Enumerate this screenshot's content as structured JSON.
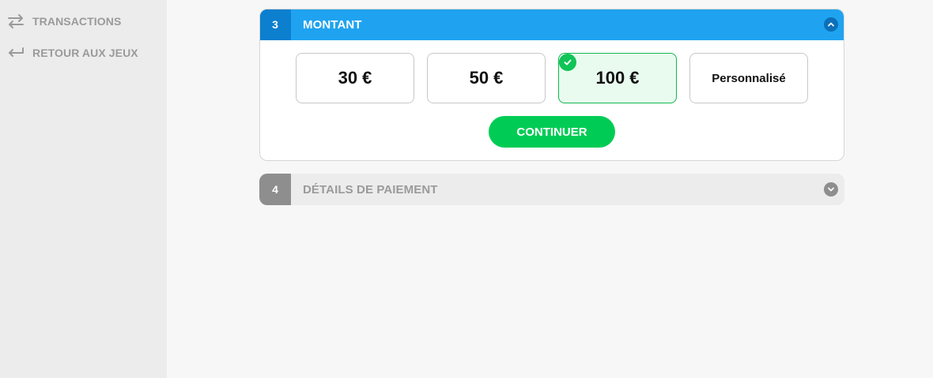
{
  "sidebar": {
    "items": [
      {
        "label": "TRANSACTIONS",
        "icon": "transfer-arrows-icon"
      },
      {
        "label": "RETOUR AUX JEUX",
        "icon": "return-arrow-icon"
      }
    ]
  },
  "step3": {
    "number": "3",
    "title": "MONTANT",
    "expanded": true,
    "amounts": [
      {
        "label": "30 €",
        "selected": false
      },
      {
        "label": "50 €",
        "selected": false
      },
      {
        "label": "100 €",
        "selected": true
      },
      {
        "label": "Personnalisé",
        "selected": false
      }
    ],
    "continue_label": "CONTINUER"
  },
  "step4": {
    "number": "4",
    "title": "DÉTAILS DE PAIEMENT",
    "expanded": false
  },
  "colors": {
    "header_blue": "#1fa3f0",
    "number_blue": "#0c7fcf",
    "success_green": "#00cc55",
    "disabled_gray": "#8e8e8e"
  }
}
